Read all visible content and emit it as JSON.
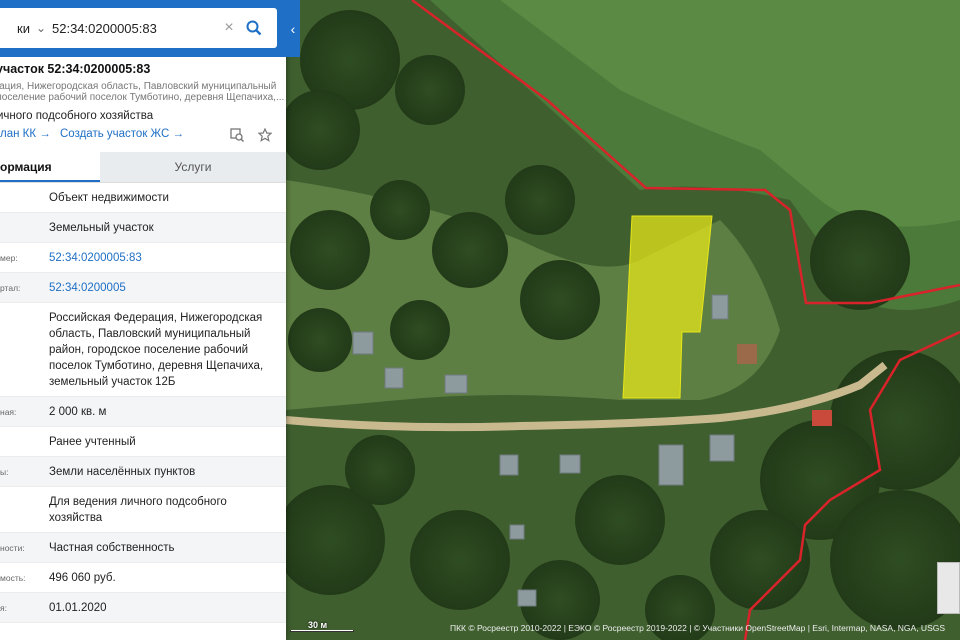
{
  "search": {
    "type_label": "ки",
    "value": "52:34:0200005:83"
  },
  "object": {
    "title": "участок 52:34:0200005:83",
    "address_short": "ерация, Нижегородская область, Павловский муниципальный",
    "address_short2": "е поселение рабочий поселок Тумботино, деревня Щепачиха,...",
    "purpose_short": "ичного подсобного хозяйства"
  },
  "links": {
    "plan_kk": "лан КК →",
    "create_zs": "Создать участок ЖС →"
  },
  "tabs": [
    {
      "label": "ормация"
    },
    {
      "label": "Услуги"
    }
  ],
  "rows": [
    {
      "label": "",
      "value": "Объект недвижимости"
    },
    {
      "label": "",
      "value": "Земельный участок"
    },
    {
      "label": "мер:",
      "value": "52:34:0200005:83",
      "link": true
    },
    {
      "label": "ртал:",
      "value": "52:34:0200005",
      "link": true
    },
    {
      "label": "",
      "value": "Российская Федерация, Нижегородская область, Павловский муниципальный район, городское поселение рабочий поселок Тумботино, деревня Щепачиха, земельный участок 12Б"
    },
    {
      "label": "ная:",
      "value": "2 000 кв. м"
    },
    {
      "label": "",
      "value": "Ранее учтенный"
    },
    {
      "label": "ы:",
      "value": "Земли населённых пунктов"
    },
    {
      "label": "",
      "value": "Для ведения личного подсобного хозяйства"
    },
    {
      "label": "ности:",
      "value": "Частная собственность"
    },
    {
      "label": "мость:",
      "value": "496 060 руб."
    },
    {
      "label": "я:",
      "value": "01.01.2020"
    }
  ],
  "map": {
    "scale": "30 м",
    "attribution": "ПКК © Росреестр 2010-2022 | ЕЭКО © Росреестр 2019-2022 | © Участники OpenStreetMap | Esri, Intermap, NASA, NGA, USGS"
  },
  "colors": {
    "accent": "#1e6fc5",
    "parcel": "#e6e619",
    "boundary": "#d9232a"
  },
  "icons": [
    "chevron-down-icon",
    "clear-icon",
    "search-icon",
    "collapse-icon",
    "measure-icon",
    "star-icon"
  ]
}
